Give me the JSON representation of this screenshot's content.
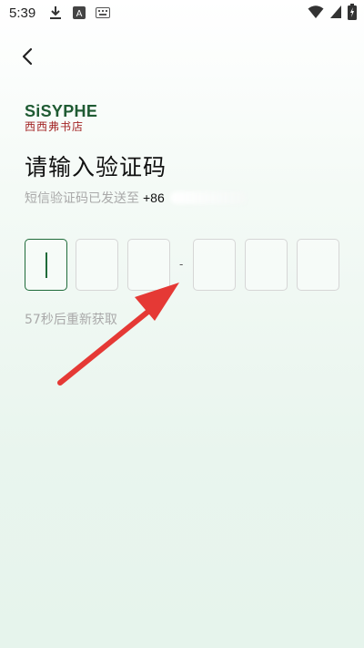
{
  "status_bar": {
    "time": "5:39",
    "icons": [
      "download-icon",
      "text-a-icon",
      "keyboard-icon"
    ],
    "right_icons": [
      "wifi-icon",
      "cellular-signal-icon",
      "battery-charging-icon"
    ]
  },
  "header": {
    "back_icon": "chevron-left-icon"
  },
  "logo": {
    "brand": "SiSYPHE",
    "chinese": "西西弗书店",
    "brand_color": "#1f5b33",
    "chinese_color": "#a32525"
  },
  "main": {
    "title": "请输入验证码",
    "subtitle": "短信验证码已发送至",
    "phone_prefix": "+86",
    "code_separator": "-",
    "countdown": "57秒后重新获取"
  },
  "code_inputs": [
    "",
    "",
    "",
    "",
    "",
    ""
  ],
  "colors": {
    "accent": "#1f6b3a",
    "box_border": "#d6d6d6",
    "hint_text": "#a9a9a9",
    "annotation_arrow": "#e53935"
  }
}
